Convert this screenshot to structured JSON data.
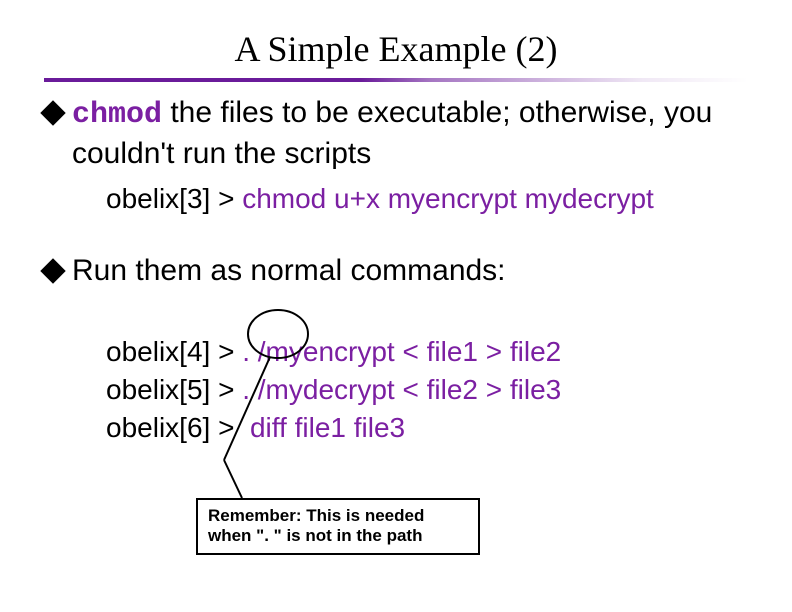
{
  "title": "A Simple Example (2)",
  "bullet1": {
    "keyword": "chmod",
    "rest": " the files to be executable; otherwise, you couldn't run the scripts"
  },
  "code1": {
    "prompt": "obelix[3] > ",
    "cmd": "chmod u+x myencrypt mydecrypt"
  },
  "bullet2": {
    "keyword": "Run",
    "rest": " them as normal commands:"
  },
  "code2": {
    "l1prompt": "obelix[4] > ",
    "l1cmd": ". /myencrypt < file1 > file2",
    "l2prompt": "obelix[5] > ",
    "l2cmd": ". /mydecrypt < file2 > file3",
    "l3prompt": "obelix[6] > ",
    "l3cmd": " diff file1 file3"
  },
  "callout": {
    "line1": "Remember: This is needed",
    "line2": "when \". \" is not in the path"
  }
}
